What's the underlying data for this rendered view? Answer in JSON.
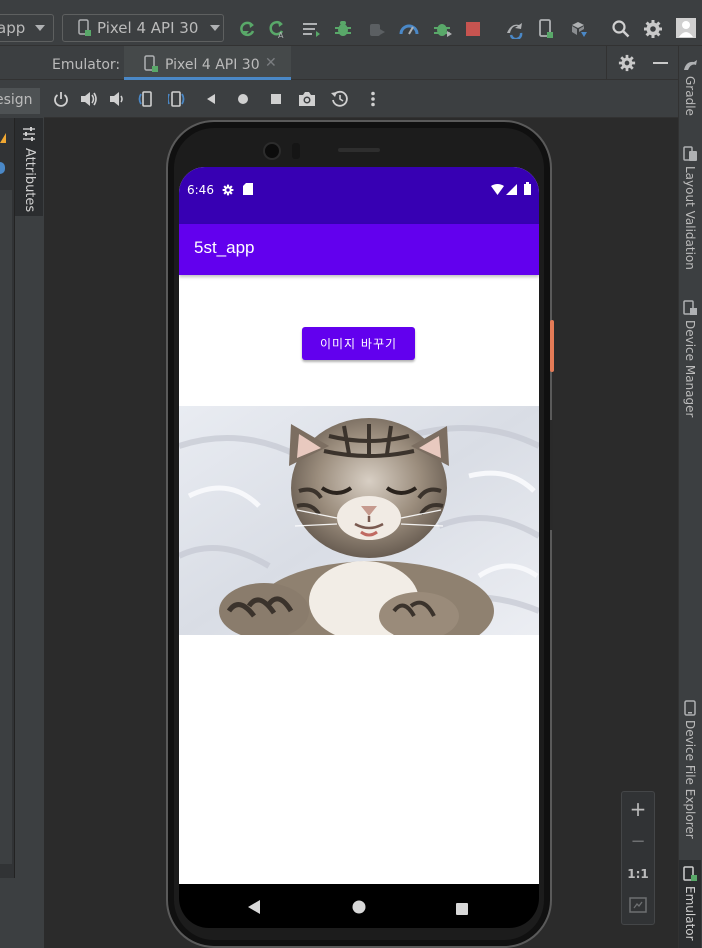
{
  "toolbar": {
    "app_config": "app",
    "device_selector": "Pixel 4 API 30",
    "icons": [
      "apply-changes-icon",
      "apply-code-changes-icon",
      "logcat-icon",
      "debug-icon",
      "attach-debugger-icon",
      "profile-icon",
      "apply-changes-restart-icon",
      "stop-icon",
      "sync-gradle-icon",
      "avd-manager-icon",
      "sdk-manager-icon",
      "search-icon",
      "settings-icon",
      "user-icon"
    ],
    "colors": {
      "run": "#59a869",
      "stop": "#c75450"
    }
  },
  "left_panel": {
    "design_tab": "esign",
    "attributes_tab": "Attributes"
  },
  "emulator": {
    "label": "Emulator:",
    "tab_label": "Pixel 4 API 30",
    "controls": [
      "power-icon",
      "volume-up-icon",
      "volume-down-icon",
      "rotate-left-icon",
      "rotate-right-icon",
      "back-icon",
      "home-icon",
      "overview-icon",
      "screenshot-icon",
      "snapshot-icon",
      "more-icon"
    ]
  },
  "right_stripe": {
    "tabs": [
      "Gradle",
      "Layout Validation",
      "Device Manager",
      "Device File Explorer",
      "Emulator"
    ]
  },
  "device": {
    "status_time": "6:46",
    "app_title": "5st_app",
    "button_label": "이미지 바꾸기",
    "colors": {
      "status_bar": "#3700b3",
      "app_bar": "#6200ee",
      "button": "#6200ee"
    }
  },
  "zoom": {
    "zoom_in": "+",
    "zoom_out": "−",
    "actual_size": "1:1"
  }
}
